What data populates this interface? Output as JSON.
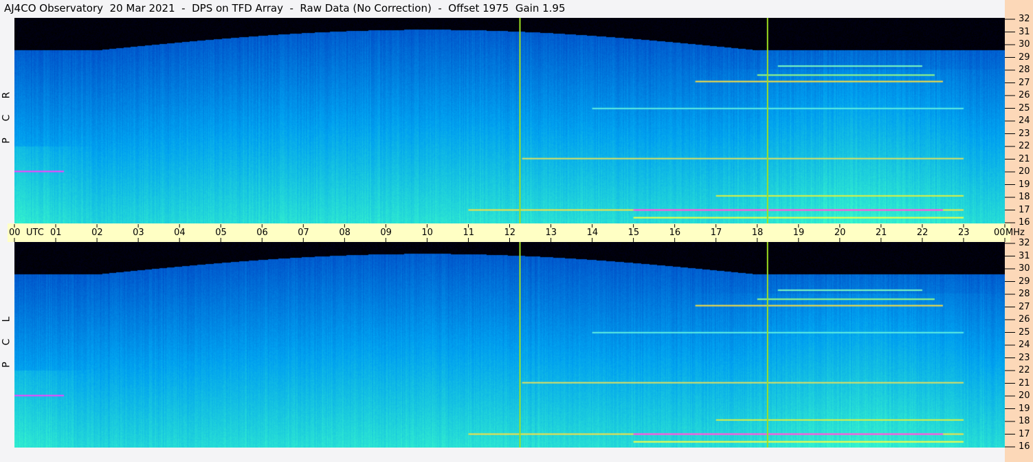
{
  "title": "AJ4CO Observatory  20 Mar 2021  -  DPS on TFD Array  -  Raw Data (No Correction)  -  Offset 1975  Gain 1.95",
  "panels": [
    {
      "label": [
        "R",
        "C",
        "P"
      ]
    },
    {
      "label": [
        "L",
        "C",
        "P"
      ]
    }
  ],
  "time_axis": {
    "unit": "UTC",
    "ticks": [
      "00",
      "01",
      "02",
      "03",
      "04",
      "05",
      "06",
      "07",
      "08",
      "09",
      "10",
      "11",
      "12",
      "13",
      "14",
      "15",
      "16",
      "17",
      "18",
      "19",
      "20",
      "21",
      "22",
      "23",
      "00"
    ]
  },
  "freq_axis": {
    "unit": "MHz",
    "ticks": [
      "32",
      "31",
      "30",
      "29",
      "28",
      "27",
      "26",
      "25",
      "24",
      "23",
      "22",
      "21",
      "20",
      "19",
      "18",
      "17",
      "16"
    ]
  },
  "chart_data": {
    "type": "heatmap",
    "title": "AJ4CO Observatory 20 Mar 2021 - DPS on TFD Array - Raw Data (No Correction) - Offset 1975 Gain 1.95",
    "xlabel": "UTC",
    "ylabel": "MHz",
    "xlim": [
      0,
      24
    ],
    "ylim": [
      16,
      32
    ],
    "markers_utc": [
      12.25,
      18.25
    ],
    "series": [
      {
        "name": "RCP"
      },
      {
        "name": "LCP"
      }
    ],
    "colors": {
      "low": "#000000",
      "mid": "#1040e0",
      "high": "#20e0e0",
      "peak": "#ff40ff",
      "marker": "#a0e020"
    }
  }
}
